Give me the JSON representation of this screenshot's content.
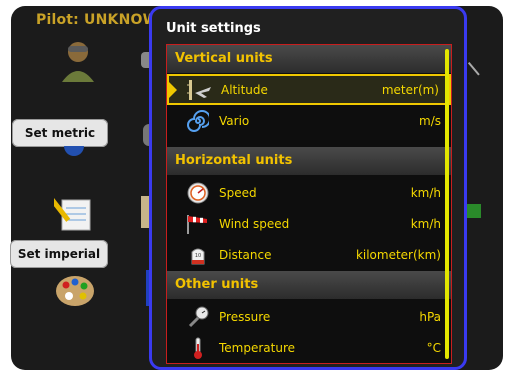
{
  "background": {
    "pilot_label": "Pilot: UNKNOW",
    "set_metric_label": "Set metric",
    "set_imperial_label": "Set imperial"
  },
  "dialog": {
    "title": "Unit settings",
    "sections": {
      "vertical": "Vertical units",
      "horizontal": "Horizontal units",
      "other": "Other units"
    },
    "rows": {
      "altitude": {
        "label": "Altitude",
        "value": "meter(m)",
        "icon": "altitude-plane-icon"
      },
      "vario": {
        "label": "Vario",
        "value": "m/s",
        "icon": "spiral-icon"
      },
      "speed": {
        "label": "Speed",
        "value": "km/h",
        "icon": "speedometer-icon"
      },
      "wind_speed": {
        "label": "Wind speed",
        "value": "km/h",
        "icon": "windsock-icon"
      },
      "distance": {
        "label": "Distance",
        "value": "kilometer(km)",
        "icon": "distance-marker-icon"
      },
      "pressure": {
        "label": "Pressure",
        "value": "hPa",
        "icon": "pressure-gauge-icon"
      },
      "temperature": {
        "label": "Temperature",
        "value": "°C",
        "icon": "thermometer-icon"
      }
    }
  },
  "colors": {
    "accent": "#f5d800",
    "dialog_border": "#3a3af0",
    "list_border": "#c81e1e",
    "pilot_label": "#c9a227"
  }
}
